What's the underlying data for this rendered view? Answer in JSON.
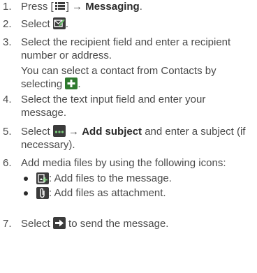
{
  "steps": [
    {
      "num": "1.",
      "t1": "Press [",
      "t2": "] → ",
      "bold": "Messaging",
      "t3": "."
    },
    {
      "num": "2.",
      "t1": "Select ",
      "t2": "."
    },
    {
      "num": "3.",
      "t1": "Select the recipient field and enter a recipient number or address.",
      "t2": "You can select a contact from Contacts by selecting ",
      "t3": "."
    },
    {
      "num": "4.",
      "t1": "Select the text input field and enter your message."
    },
    {
      "num": "5.",
      "t1": "Select ",
      "t2": " → ",
      "bold": "Add subject",
      "t3": " and enter a subject (if necessary)."
    },
    {
      "num": "6.",
      "t1": "Add media files by using the following icons:"
    },
    {
      "num": "7.",
      "t1": "Select ",
      "t2": " to send the message."
    }
  ],
  "bullets": [
    {
      "text": ": Add files to the message.",
      "icon": "add-media-icon"
    },
    {
      "text": ": Add files as attachment.",
      "icon": "paperclip-icon"
    }
  ],
  "icons": {
    "menu": "menu-key-icon",
    "compose": "compose-message-icon",
    "add": "plus-icon",
    "more": "more-options-icon",
    "send": "send-arrow-icon"
  },
  "colors": {
    "text": "#4a4a4a",
    "bold": "#2a2a2a",
    "icon_dark": "#3b3b3b",
    "icon_green": "#2f7a2f"
  }
}
